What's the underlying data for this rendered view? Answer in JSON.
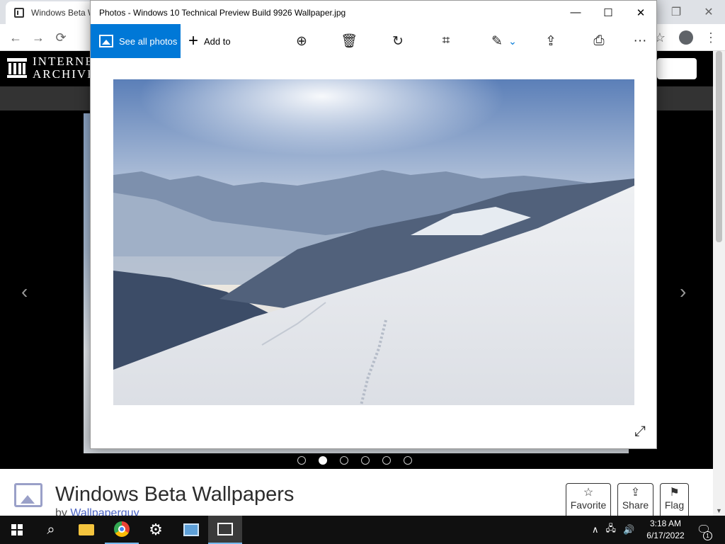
{
  "browser": {
    "tab_title": "Windows Beta W",
    "window_controls": {
      "restore": "❐",
      "close": "✕"
    },
    "nav": {
      "back": "←",
      "forward": "→",
      "reload": "⟳",
      "more": "⋮"
    }
  },
  "ia": {
    "logo_line1": "INTERNET",
    "logo_line2": "ARCHIVE"
  },
  "viewer": {
    "prev_arrow": "‹",
    "next_arrow": "›",
    "dots": 6,
    "active_dot": 1
  },
  "item": {
    "title": "Windows Beta Wallpapers",
    "by_prefix": "by ",
    "author": "Wallpaperguy",
    "actions": [
      {
        "label": "Favorite",
        "icon": "☆"
      },
      {
        "label": "Share",
        "icon": "⇪"
      },
      {
        "label": "Flag",
        "icon": "⚑"
      }
    ]
  },
  "photos": {
    "title": "Photos - Windows 10 Technical Preview Build 9926 Wallpaper.jpg",
    "see_all_label": "See all photos",
    "add_to_label": "Add to",
    "toolbar_icons": {
      "zoom": "⊕",
      "delete": "🗑",
      "rotate": "↻",
      "crop": "⌗",
      "edit": "✎",
      "edit_chevron": "⌄",
      "share": "⇪",
      "print": "⎙",
      "more": "···"
    },
    "window_controls": {
      "minimize": "—",
      "maximize": "☐",
      "close": "✕"
    },
    "expand_icon": "⤢"
  },
  "taskbar": {
    "time": "3:18 AM",
    "date": "6/17/2022",
    "notification_count": "1",
    "tray_chevron": "∧",
    "network_icon": "🖧",
    "volume_icon": "🔊",
    "search_icon": "⌕",
    "notification_icon": "🗨"
  }
}
